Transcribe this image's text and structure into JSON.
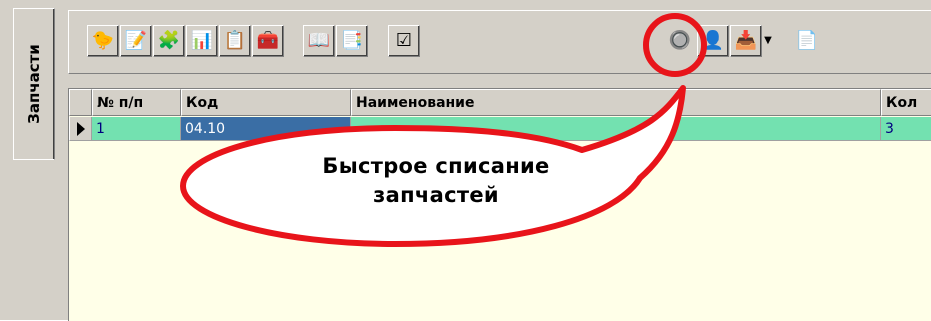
{
  "sidebar": {
    "tabs": [
      {
        "label": "Запчасти"
      }
    ]
  },
  "toolbar": {
    "buttons": [
      {
        "icon": "add-part-icon",
        "glyph": "🐤"
      },
      {
        "icon": "edit-document-icon",
        "glyph": "📝"
      },
      {
        "icon": "hierarchy-icon",
        "glyph": "🧩"
      },
      {
        "icon": "columns-icon",
        "glyph": "📊"
      },
      {
        "icon": "checklist-edit-icon",
        "glyph": "📋"
      },
      {
        "icon": "red-box-icon",
        "glyph": "🧰"
      },
      {
        "icon": "book-icon",
        "glyph": "📖"
      },
      {
        "icon": "table-arrows-icon",
        "glyph": "📑"
      },
      {
        "icon": "checkbox-ab-icon",
        "glyph": "☑"
      },
      {
        "icon": "quick-writeoff-icon",
        "glyph": "🔘"
      },
      {
        "icon": "user-icon",
        "glyph": "👤"
      },
      {
        "icon": "download-icon",
        "glyph": "📥"
      },
      {
        "icon": "copy-pages-icon",
        "glyph": "📄"
      }
    ]
  },
  "grid": {
    "columns": [
      "№ п/п",
      "Код",
      "Наименование",
      "Кол"
    ],
    "rows": [
      {
        "num": "1",
        "code": "04.10",
        "name": "",
        "qty": "3"
      }
    ]
  },
  "callout": {
    "text_line1": "Быстрое списание",
    "text_line2": "запчастей"
  },
  "colors": {
    "highlight": "#e8141a",
    "row_green": "#73e1b0",
    "window_bg": "#d4d0c8"
  }
}
